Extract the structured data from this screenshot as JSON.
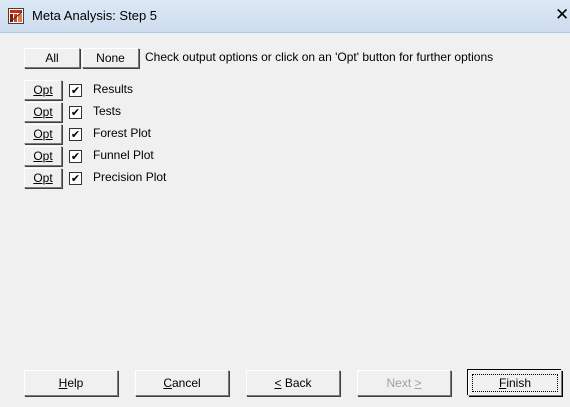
{
  "window": {
    "title": "Meta Analysis: Step 5",
    "close_glyph": "✕",
    "icon": "app-icon"
  },
  "toolbar": {
    "all_label": "All",
    "none_label": "None",
    "instruction": "Check output options or click on an 'Opt' button for further options"
  },
  "options": [
    {
      "opt_label": "Opt",
      "label": "Results",
      "checked": true
    },
    {
      "opt_label": "Opt",
      "label": "Tests",
      "checked": true
    },
    {
      "opt_label": "Opt",
      "label": "Forest Plot",
      "checked": true
    },
    {
      "opt_label": "Opt",
      "label": "Funnel Plot",
      "checked": true
    },
    {
      "opt_label": "Opt",
      "label": "Precision Plot",
      "checked": true
    }
  ],
  "check_glyph": "✔",
  "footer": {
    "help": {
      "before": "",
      "mnemonic": "H",
      "after": "elp",
      "enabled": true
    },
    "cancel": {
      "before": "",
      "mnemonic": "C",
      "after": "ancel",
      "enabled": true
    },
    "back": {
      "before": "",
      "mnemonic": "<",
      "after": " Back",
      "enabled": true
    },
    "next": {
      "before": "Next ",
      "mnemonic": ">",
      "after": "",
      "enabled": false
    },
    "finish": {
      "before": "",
      "mnemonic": "F",
      "after": "inish",
      "enabled": true,
      "default": true
    }
  },
  "colors": {
    "title_bar": "#dbe8f5",
    "dialog_bg": "#f0f0f0",
    "disabled_text": "#a0a0a0"
  }
}
